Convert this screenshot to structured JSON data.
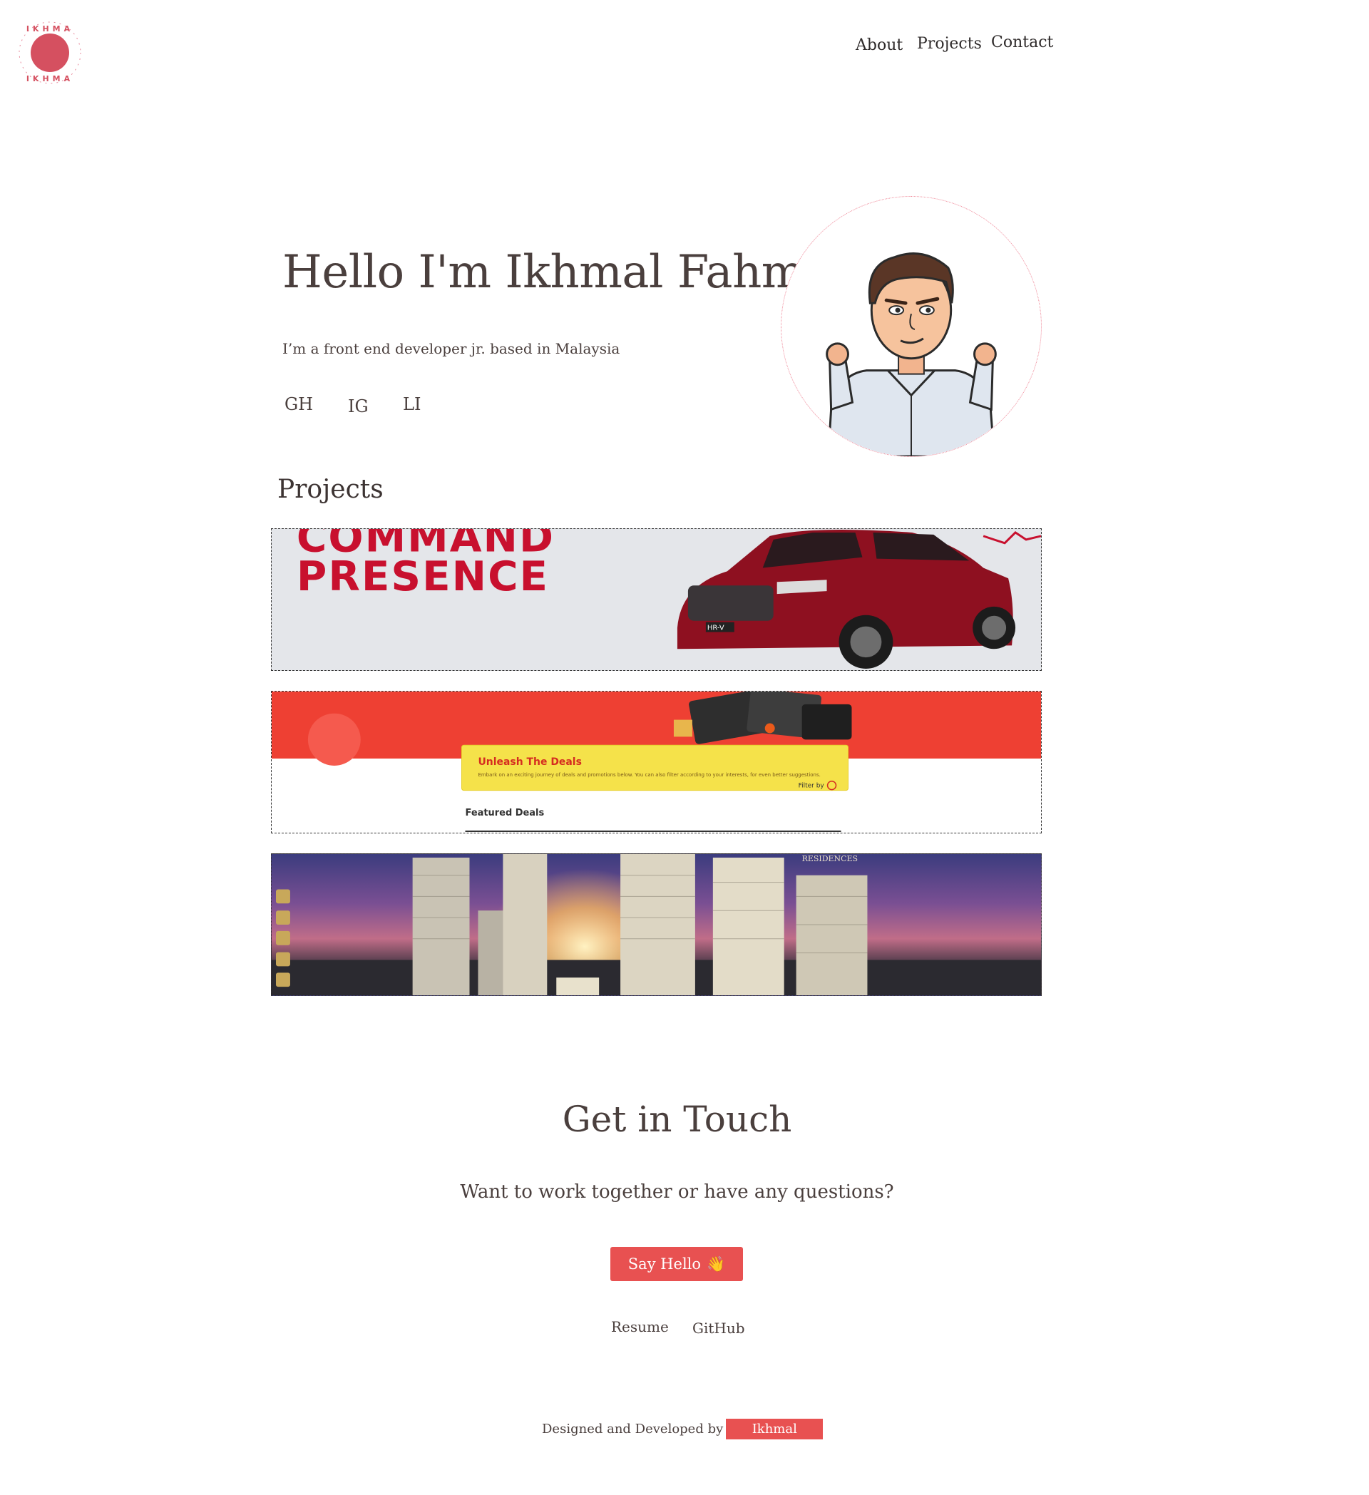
{
  "logo": {
    "ring_text": "IKHMAL",
    "accent": "#d55060"
  },
  "nav": {
    "about": "About",
    "projects": "Projects",
    "contact": "Contact"
  },
  "hero": {
    "title": "Hello I'm Ikhmal Fahmi",
    "subtitle": "I’m a front end developer jr.  based in Malaysia",
    "social": {
      "gh": "GH",
      "ig": "IG",
      "li": "LI"
    }
  },
  "projects": {
    "heading": "Projects",
    "items": [
      {
        "headline_1": "COMMAND",
        "headline_2": "PRESENCE",
        "badge": "HR-V"
      },
      {
        "card_title": "Unleash The Deals",
        "card_text": "Embark on an exciting journey of deals and promotions below. You can also filter according to your interests, for even better suggestions.",
        "filter": "Filter by",
        "featured": "Featured Deals"
      },
      {
        "brand": "RESIDENCES"
      }
    ]
  },
  "contact": {
    "title": "Get in Touch",
    "subtitle": "Want to work together or have any questions?",
    "button": "Say Hello",
    "button_emoji": "👋",
    "resume": "Resume",
    "github": "GitHub"
  },
  "footer": {
    "text": "Designed and Developed by",
    "name": "Ikhmal"
  },
  "colors": {
    "accent": "#e85151",
    "text": "#4a3f3d"
  }
}
